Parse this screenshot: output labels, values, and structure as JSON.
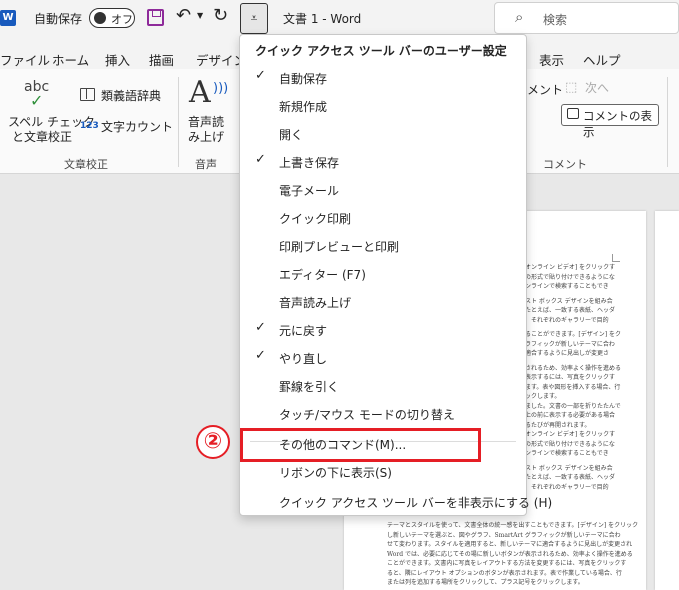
{
  "titlebar": {
    "app_logo": "W",
    "autosave_label": "自動保存",
    "autosave_state": "オフ",
    "doc_title": "文書 1  -  Word",
    "search_placeholder": "検索",
    "icons": [
      "word-logo",
      "save-icon",
      "undo-icon",
      "redo-icon",
      "customize-qat-icon",
      "search-icon"
    ]
  },
  "tabs": [
    "ファイル",
    "ホーム",
    "挿入",
    "描画",
    "デザイン",
    "表示",
    "ヘルプ"
  ],
  "ribbon": {
    "proofing": {
      "abc": "abc",
      "spell_check_line1": "スペル チェック",
      "spell_check_line2": "と文章校正",
      "thesaurus": "類義語辞典",
      "word_count": "文字カウント",
      "word_count_icon_text": "123",
      "group_label": "文章校正"
    },
    "speech": {
      "read_aloud_line1": "音声読",
      "read_aloud_line2": "み上げ",
      "group_label": "音声"
    },
    "comments": {
      "delete_partial": "メント",
      "next": "次へ",
      "show_comments": "コメントの表示",
      "group_label": "コメント"
    }
  },
  "menu": {
    "title": "クイック アクセス ツール バーのユーザー設定",
    "items": [
      {
        "label": "自動保存",
        "checked": "✓"
      },
      {
        "label": "新規作成",
        "checked": ""
      },
      {
        "label": "開く",
        "checked": ""
      },
      {
        "label": "上書き保存",
        "checked": "✓"
      },
      {
        "label": "電子メール",
        "checked": ""
      },
      {
        "label": "クイック印刷",
        "checked": ""
      },
      {
        "label": "印刷プレビューと印刷",
        "checked": ""
      },
      {
        "label": "エディター (F7)",
        "checked": ""
      },
      {
        "label": "音声読み上げ",
        "checked": ""
      },
      {
        "label": "元に戻す",
        "checked": "✓"
      },
      {
        "label": "やり直し",
        "checked": "✓"
      },
      {
        "label": "罫線を引く",
        "checked": ""
      },
      {
        "label": "タッチ/マウス モードの切り替え",
        "checked": ""
      },
      {
        "label": "その他のコマンド(M)...",
        "checked": ""
      },
      {
        "label": "リボンの下に表示(S)",
        "checked": ""
      },
      {
        "label": "クイック アクセス ツール バーを非表示にする (H)",
        "checked": ""
      }
    ]
  },
  "annotation": {
    "step_number": "②",
    "color": "#e51e25"
  },
  "document": {
    "partial_lines": [
      "オンライン ビデオ] をクリックす",
      "の形式で貼り付けできるようにな",
      "ンラインで検索することもでき",
      "",
      "スト ボックス デザインを組み合",
      "たとえば、一致する表紙、ヘッダ",
      "、それぞれのギャラリーで目的",
      "",
      "ることができます。[デザイン] をク",
      "ラフィックが新しいテーマに合わ",
      "適合するように見出しが変更さ",
      "",
      "されるため、効率よく操作を進める",
      "表示するには、写真をクリックす",
      "ます。表や図形を挿入する場合、行",
      "ックします。",
      "ました。文書の一部を折りたたんで",
      "上の前に表示する必要がある場合",
      "るたびが再開されます。",
      "オンライン ビデオ] をクリックす",
      "の形式で貼り付けできるようにな",
      "ンラインで検索することもでき",
      "",
      "スト ボックス デザインを組み合",
      "たとえば、一致する表紙、ヘッダ",
      "、それぞれのギャラリーで目的"
    ],
    "full_lines": [
      "テーマとスタイルを使って、文書全体の統一感を出すこともできます。[デザイン] をクリック",
      "し新しいテーマを選ぶと、図やグラフ、SmartArt グラフィックが新しいテーマに合わ",
      "せて変わります。スタイルを適用すると、新しいテーマに適合するように見出しが変更され",
      "Word では、必要に応じてその場に新しいボタンが表示されるため、効率よく操作を進める",
      "ことができます。文書内に写真をレイアウトする方法を変更するには、写真をクリックす",
      "ると、隣にレイアウト オプションのボタンが表示されます。表で作業している場合、行",
      "または列を追加する場所をクリックして、プラス記号をクリックします。"
    ]
  }
}
